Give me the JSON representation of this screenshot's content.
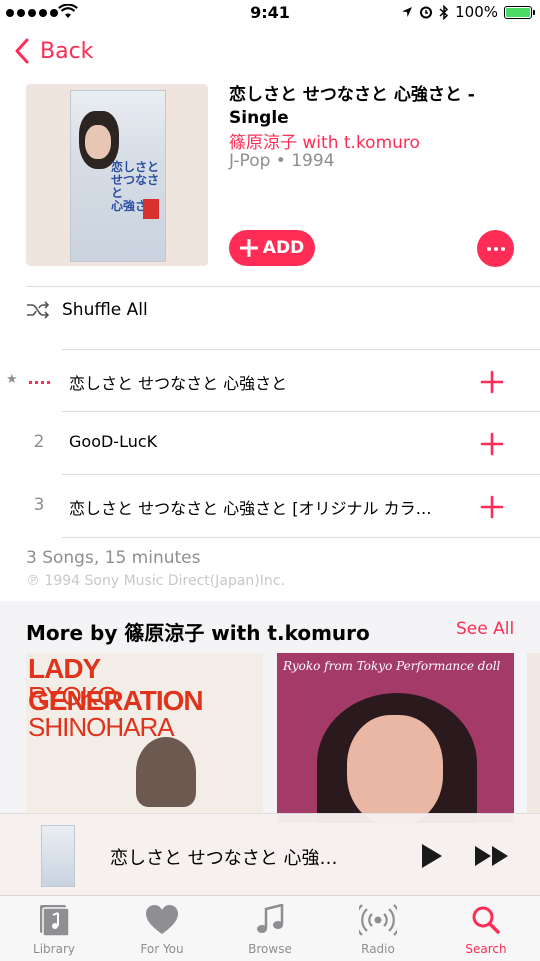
{
  "status_bar": {
    "time": "9:41",
    "battery_pct": "100%"
  },
  "nav": {
    "back_label": "Back"
  },
  "album": {
    "title": "恋しさと せつなさと 心強さと - Single",
    "artist": "篠原涼子 with t.komuro",
    "meta": "J-Pop • 1994",
    "add_label": "ADD"
  },
  "shuffle": {
    "label": "Shuffle All"
  },
  "tracks": [
    {
      "num": "",
      "title": "恋しさと せつなさと 心強さと",
      "starred": true,
      "playing": true
    },
    {
      "num": "2",
      "title": "GooD-LucK"
    },
    {
      "num": "3",
      "title": "恋しさと せつなさと 心強さと [オリジナル カラ…"
    }
  ],
  "footer": {
    "summary": "3 Songs, 15 minutes",
    "copyright": "℗ 1994 Sony Music Direct(Japan)Inc."
  },
  "more_by": {
    "title": "More by 篠原涼子 with t.komuro",
    "see_all": "See All",
    "albums": [
      {
        "cover_line1": "LADY GENERATION",
        "cover_line2": "RYOKO SHINOHARA"
      },
      {
        "cover_caption": "Ryoko from Tokyo Performance doll"
      }
    ]
  },
  "mini_player": {
    "title": "恋しさと せつなさと 心強…"
  },
  "tabs": [
    {
      "label": "Library"
    },
    {
      "label": "For You"
    },
    {
      "label": "Browse"
    },
    {
      "label": "Radio"
    },
    {
      "label": "Search",
      "active": true
    }
  ],
  "colors": {
    "accent": "#ff2d55",
    "secondary_text": "#8e8e93",
    "battery": "#4cd964"
  }
}
